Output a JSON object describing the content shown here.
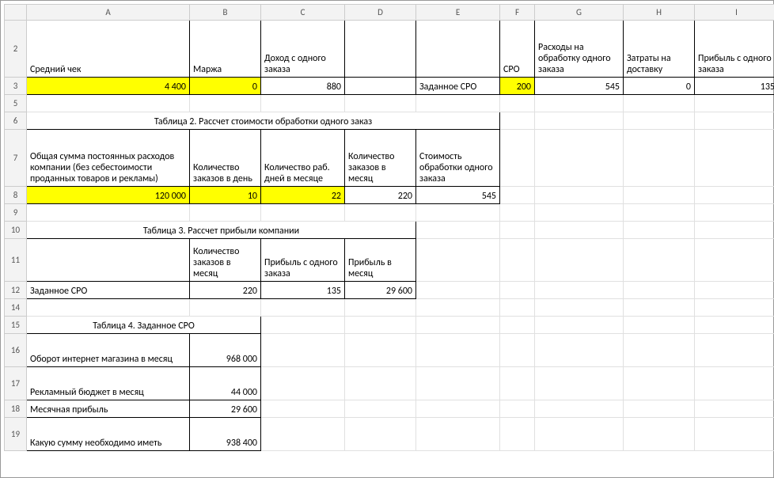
{
  "columns": [
    "A",
    "B",
    "C",
    "D",
    "E",
    "F",
    "G",
    "H",
    "I"
  ],
  "rows": [
    "2",
    "3",
    "5",
    "6",
    "7",
    "8",
    "9",
    "10",
    "11",
    "12",
    "14",
    "15",
    "16",
    "17",
    "18",
    "19"
  ],
  "r2": {
    "A": "Средний чек",
    "B": "Маржа",
    "C": "Доход с одного заказа",
    "F": "CPO",
    "G": "Расходы на обработку одного заказа",
    "H": "Затраты на доставку",
    "I": "Прибыль с одного заказа"
  },
  "r3": {
    "A": "4 400",
    "B": "0",
    "C": "880",
    "E": "Заданное CPO",
    "F": "200",
    "G": "545",
    "H": "0",
    "I": "135"
  },
  "r6": {
    "title": "Таблица 2. Рассчет стоимости обработки одного заказ"
  },
  "r7": {
    "A": "Общая сумма постоянных расходов компании (без себестоимости проданных товаров и рекламы)",
    "B": "Количество заказов в день",
    "C": "Количество раб. дней в месяце",
    "D": "Количество заказов в месяц",
    "E": "Стоимость обработки одного заказа"
  },
  "r8": {
    "A": "120 000",
    "B": "10",
    "C": "22",
    "D": "220",
    "E": "545"
  },
  "r10": {
    "title": "Таблица 3. Рассчет прибыли компании"
  },
  "r11": {
    "B": "Количество заказов в месяц",
    "C": "Прибыль с одного заказа",
    "D": "Прибыль в месяц"
  },
  "r12": {
    "A": "Заданное CPO",
    "B": "220",
    "C": "135",
    "D": "29 600"
  },
  "r15": {
    "title": "Таблица 4. Заданное CPO"
  },
  "r16": {
    "A": "Оборот интернет магазина в месяц",
    "B": "968 000"
  },
  "r17": {
    "A": "Рекламный бюджет в месяц",
    "B": "44 000"
  },
  "r18": {
    "A": "Месячная прибыль",
    "B": "29 600"
  },
  "r19": {
    "A": "Какую сумму необходимо иметь",
    "B": "938 400"
  }
}
